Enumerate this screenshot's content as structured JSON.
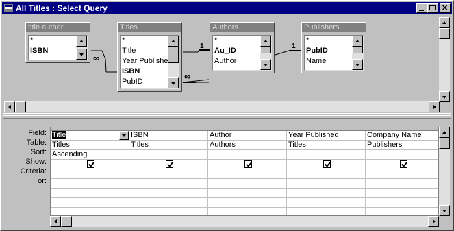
{
  "window": {
    "title": "All Titles : Select Query"
  },
  "design": {
    "tables": [
      {
        "name": "title author",
        "fields": [
          "*",
          "ISBN"
        ],
        "keys": [
          false,
          true
        ]
      },
      {
        "name": "Titles",
        "fields": [
          "*",
          "Title",
          "Year Published",
          "ISBN",
          "PubID"
        ],
        "keys": [
          false,
          false,
          false,
          true,
          false
        ]
      },
      {
        "name": "Authors",
        "fields": [
          "*",
          "Au_ID",
          "Author"
        ],
        "keys": [
          false,
          true,
          false
        ]
      },
      {
        "name": "Publishers",
        "fields": [
          "*",
          "PubID",
          "Name"
        ],
        "keys": [
          false,
          true,
          false
        ]
      }
    ],
    "relationship_one": "1",
    "relationship_many": "∞"
  },
  "grid": {
    "row_labels": [
      "Field:",
      "Table:",
      "Sort:",
      "Show:",
      "Criteria:",
      "or:"
    ],
    "columns": [
      {
        "field": "Title",
        "table": "Titles",
        "sort": "Ascending",
        "show": true
      },
      {
        "field": "ISBN",
        "table": "Titles",
        "sort": "",
        "show": true
      },
      {
        "field": "Author",
        "table": "Authors",
        "sort": "",
        "show": true
      },
      {
        "field": "Year Published",
        "table": "Titles",
        "sort": "",
        "show": true
      },
      {
        "field": "Company Name",
        "table": "Publishers",
        "sort": "",
        "show": true
      }
    ]
  }
}
